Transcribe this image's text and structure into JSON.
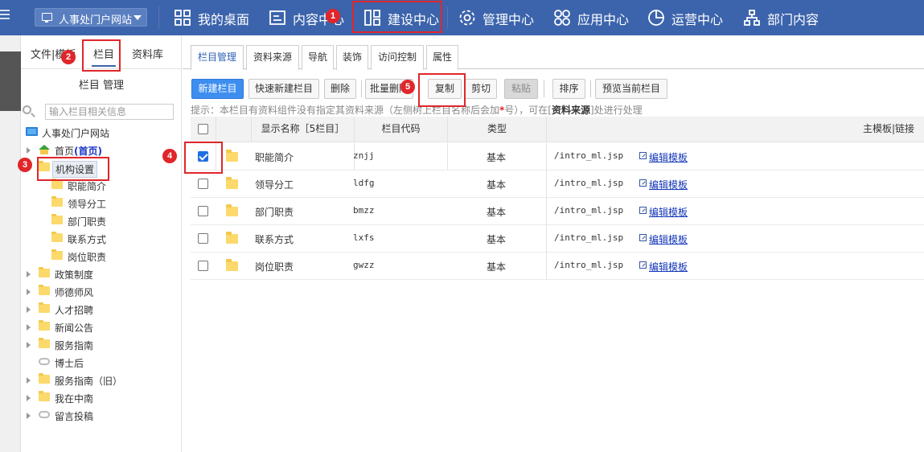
{
  "topbar": {
    "site_select": "人事处门户网站",
    "nav": [
      {
        "label": "我的桌面",
        "icon": "grid-icon"
      },
      {
        "label": "内容中心",
        "icon": "document-icon"
      },
      {
        "label": "建设中心",
        "icon": "build-grid-icon"
      },
      {
        "label": "管理中心",
        "icon": "gear-icon"
      },
      {
        "label": "应用中心",
        "icon": "apps-icon"
      },
      {
        "label": "运营中心",
        "icon": "pie-chart-icon"
      },
      {
        "label": "部门内容",
        "icon": "org-tree-icon"
      }
    ]
  },
  "sidebar": {
    "tabs": [
      "文件|模板",
      "栏目",
      "资料库"
    ],
    "title": "栏目 管理",
    "search_placeholder": "输入栏目相关信息",
    "root": "人事处门户网站",
    "home_label": "首页",
    "home_tag": "(首页)",
    "jigou": "机构设置",
    "jigou_children": [
      "职能简介",
      "领导分工",
      "部门职责",
      "联系方式",
      "岗位职责"
    ],
    "others": [
      "政策制度",
      "师德师风",
      "人才招聘",
      "新闻公告",
      "服务指南",
      "博士后",
      "服务指南（旧）",
      "我在中南",
      "留言投稿"
    ]
  },
  "main": {
    "tabs": [
      "栏目管理",
      "资料来源",
      "导航",
      "装饰",
      "访问控制",
      "属性"
    ],
    "buttons": {
      "new_column": "新建栏目",
      "quick_new": "快速新建栏目",
      "delete": "删除",
      "batch_delete": "批量删除",
      "copy": "复制",
      "cut": "剪切",
      "paste": "粘贴",
      "sort": "排序",
      "preview": "预览当前栏目"
    },
    "hint": {
      "prefix": "提示：本栏目有资料组件没有指定其资料来源（左侧树上栏目名称后会加",
      "star": "*",
      "mid": "号），可在[",
      "bold": "资料来源",
      "suffix": "]处进行处理"
    },
    "table": {
      "headers": [
        "显示名称［5栏目］",
        "栏目代码",
        "类型",
        "主模板|链接"
      ],
      "edit_label": "编辑模板",
      "rows": [
        {
          "name": "职能简介",
          "code": "znjj",
          "type": "基本",
          "template": "/intro_ml.jsp",
          "checked": true
        },
        {
          "name": "领导分工",
          "code": "ldfg",
          "type": "基本",
          "template": "/intro_ml.jsp",
          "checked": false
        },
        {
          "name": "部门职责",
          "code": "bmzz",
          "type": "基本",
          "template": "/intro_ml.jsp",
          "checked": false
        },
        {
          "name": "联系方式",
          "code": "lxfs",
          "type": "基本",
          "template": "/intro_ml.jsp",
          "checked": false
        },
        {
          "name": "岗位职责",
          "code": "gwzz",
          "type": "基本",
          "template": "/intro_ml.jsp",
          "checked": false
        }
      ]
    }
  },
  "annotations": [
    "1",
    "2",
    "3",
    "4",
    "5"
  ]
}
